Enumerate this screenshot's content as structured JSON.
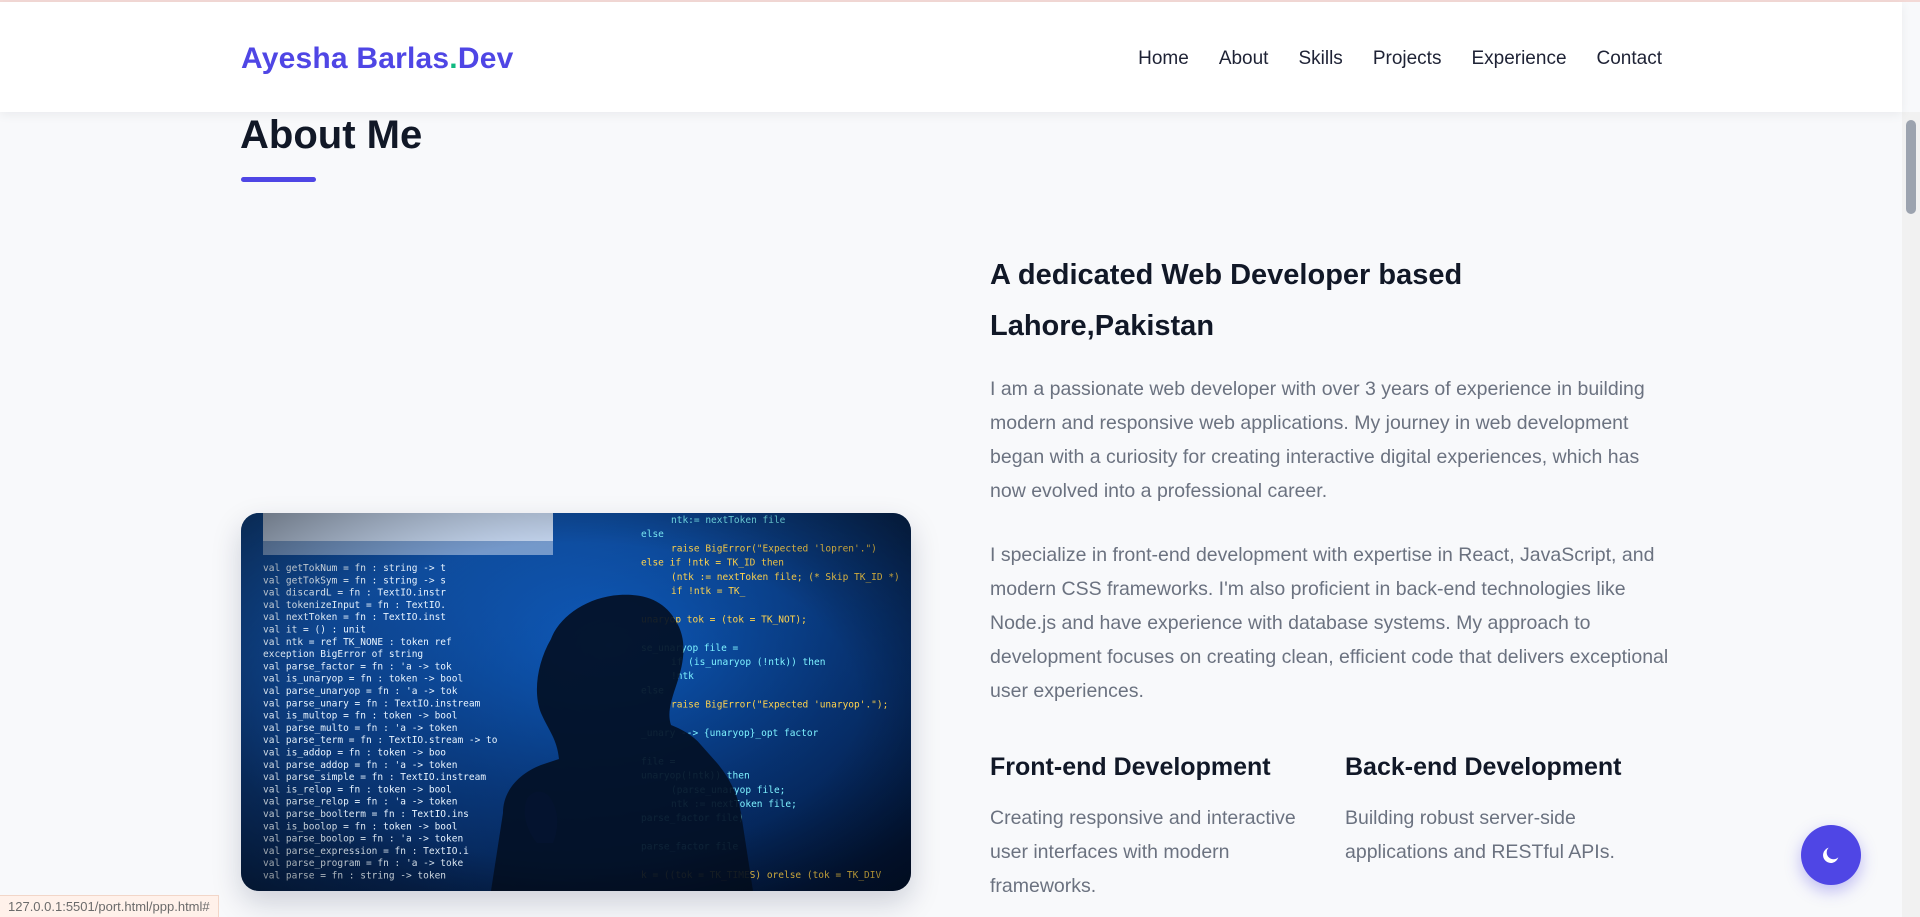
{
  "header": {
    "logo_name": "Ayesha Barlas",
    "logo_dot": ".",
    "logo_suffix": "Dev",
    "nav": [
      "Home",
      "About",
      "Skills",
      "Projects",
      "Experience",
      "Contact"
    ]
  },
  "section": {
    "title": "About Me"
  },
  "about": {
    "heading": "A dedicated Web Developer based Lahore,Pakistan",
    "paragraph1": "I am a passionate web developer with over 3 years of experience in building modern and responsive web applications. My journey in web development began with a curiosity for creating interactive digital experiences, which has now evolved into a professional career.",
    "paragraph2": "I specialize in front-end development with expertise in React, JavaScript, and modern CSS frameworks. I'm also proficient in back-end technologies like Node.js and have experience with database systems. My approach to development focuses on creating clean, efficient code that delivers exceptional user experiences.",
    "services": [
      {
        "title": "Front-end Development",
        "desc": "Creating responsive and interactive user interfaces with modern frameworks."
      },
      {
        "title": "Back-end Development",
        "desc": "Building robust server-side applications and RESTful APIs."
      }
    ]
  },
  "photo": {
    "code_lines_left": [
      "val getTokNum = fn : string -> t",
      "val getTokSym = fn : string -> s",
      "val discardL = fn : TextIO.instr",
      "val tokenizeInput = fn : TextIO.",
      "val nextToken = fn : TextIO.inst",
      "val it = () : unit",
      "val ntk = ref TK_NONE : token ref",
      "exception BigError of string",
      "val parse_factor = fn : 'a -> tok",
      "val is_unaryop = fn : token -> bool",
      "val parse_unaryop = fn : 'a -> tok",
      "val parse_unary = fn : TextIO.instream",
      "val is_multop = fn : token -> bool",
      "val parse_multo = fn : 'a -> token",
      "val parse_term = fn : TextIO.stream -> to",
      "val is_addop = fn : token -> boo",
      "val parse_addop = fn : 'a -> token",
      "val parse_simple = fn : TextIO.instream",
      "val is_relop = fn : token -> bool",
      "val parse_relop = fn : 'a -> token",
      "val parse_boolterm = fn : TextIO.ins",
      "val is_boolop = fn : token -> bool",
      "val parse_boolop = fn : 'a -> token",
      "val parse_expression = fn : TextIO.i",
      "val parse_program = fn : 'a -> toke",
      "val parse = fn : string -> token"
    ],
    "code_lines_right": [
      "ntk:= nextToken file",
      "else",
      "raise BigError(\"Expected 'lopren'.\")",
      "else if !ntk = TK_ID then",
      "(ntk := nextToken file; (* Skip TK_ID *)",
      "if !ntk = TK_",
      "",
      "unaryop tok = (tok = TK_NOT);",
      "",
      "se_unaryop file =",
      "if (is_unaryop (!ntk)) then",
      "!ntk",
      "else",
      "raise BigError(\"Expected 'unaryop'.\");",
      "",
      "_unary --> {unaryop}_opt factor",
      "",
      "file =",
      "unaryop(!ntk)) then",
      "(parse_unaryop file;",
      "ntk := nextToken file;",
      "parse_factor file)",
      "",
      "parse_factor file",
      "",
      "k = ((tok = TK_TIMES) orelse (tok = TK_DIV"
    ]
  },
  "floating": {
    "theme_toggle_icon": "moon-icon"
  },
  "status_bar": {
    "url": "127.0.0.1:5501/port.html/ppp.html#"
  },
  "colors": {
    "accent": "#4f46e5",
    "logo_dot": "#10b981",
    "code_text": "#7ef2ff",
    "code_highlight": "#ffd34d"
  }
}
